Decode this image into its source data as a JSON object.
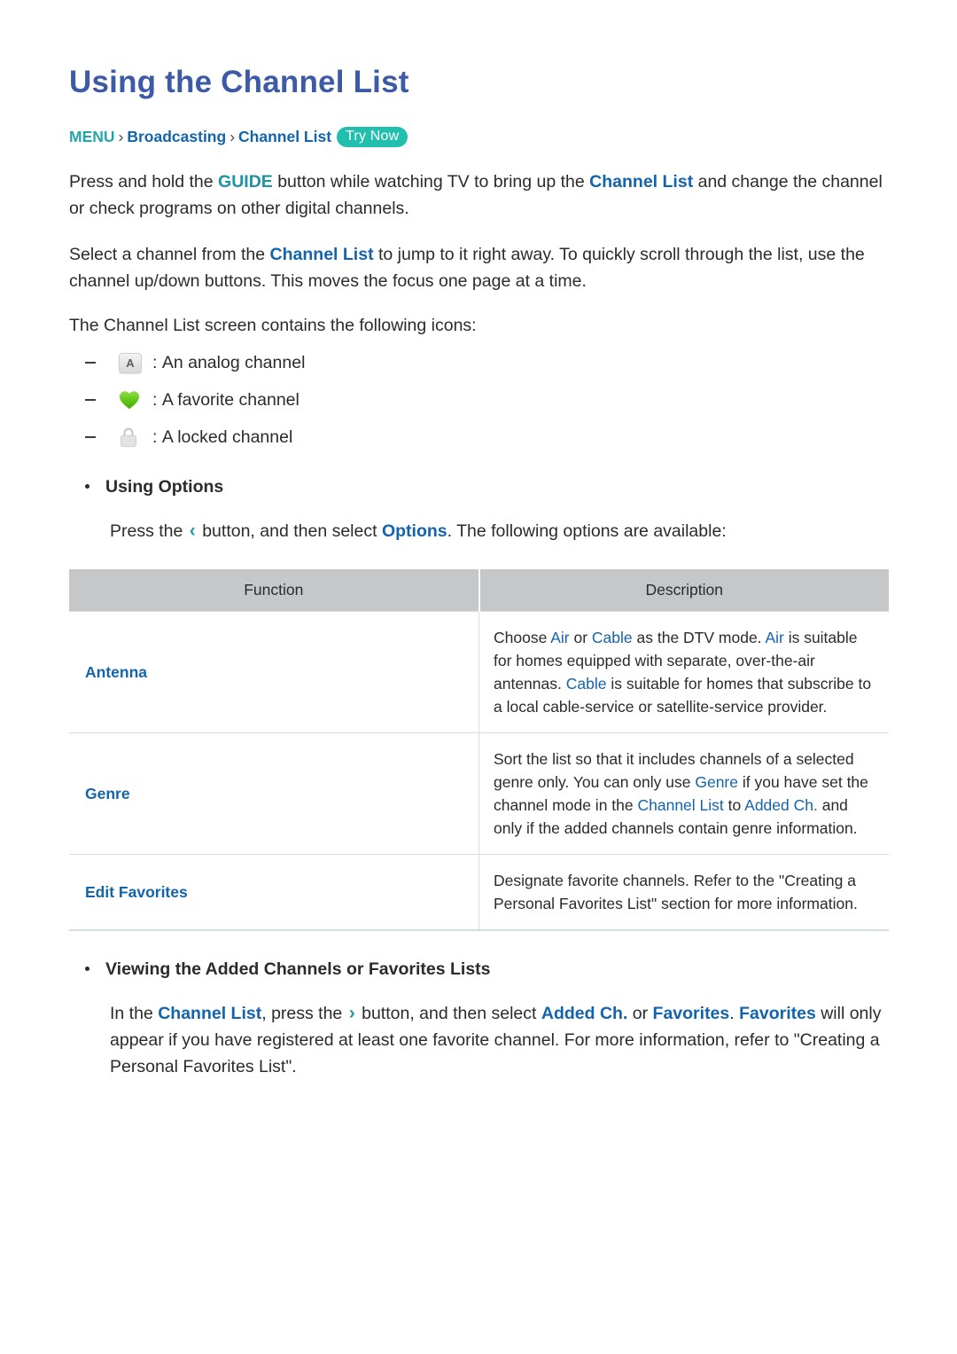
{
  "page": {
    "title": "Using the Channel List"
  },
  "breadcrumb": {
    "root": "MENU",
    "separator": "›",
    "level1": "Broadcasting",
    "level2": "Channel List",
    "badge": "Try Now"
  },
  "paragraphs": {
    "p1_a": "Press and hold the ",
    "p1_guide": "GUIDE",
    "p1_b": " button while watching TV to bring up the ",
    "p1_channel_list": "Channel List",
    "p1_c": " and change the channel or check programs on other digital channels.",
    "p2_a": "Select a channel from the ",
    "p2_channel_list": "Channel List",
    "p2_b": " to jump to it right away. To quickly scroll through the list, use the channel up/down buttons. This moves the focus one page at a time.",
    "p3": "The Channel List screen contains the following icons:"
  },
  "icon_list": [
    {
      "icon": "analog-channel-icon",
      "glyph": "A",
      "colon": ":",
      "label": "An analog channel"
    },
    {
      "icon": "favorite-heart-icon",
      "glyph": "",
      "colon": ":",
      "label": "A favorite channel"
    },
    {
      "icon": "locked-padlock-icon",
      "glyph": "",
      "colon": ":",
      "label": "A locked channel"
    }
  ],
  "using_options": {
    "heading": "Using Options",
    "body_a": "Press the ",
    "chevron": "‹",
    "body_b": " button, and then select ",
    "options_term": "Options",
    "body_c": ". The following options are available:"
  },
  "table": {
    "headers": [
      "Function",
      "Description"
    ],
    "rows": [
      {
        "function": "Antenna",
        "desc_a": "Choose ",
        "t1": "Air",
        "desc_b": " or ",
        "t2": "Cable",
        "desc_c": " as the DTV mode. ",
        "t3": "Air",
        "desc_d": " is suitable for homes equipped with separate, over-the-air antennas. ",
        "t4": "Cable",
        "desc_e": " is suitable for homes that subscribe to a local cable-service or satellite-service provider."
      },
      {
        "function": "Genre",
        "desc_a": "Sort the list so that it includes channels of a selected genre only. You can only use ",
        "t1": "Genre",
        "desc_b": " if you have set the channel mode in the ",
        "t2": "Channel List",
        "desc_c": " to ",
        "t3": "Added Ch.",
        "desc_d": " and only if the added channels contain genre information.",
        "t4": "",
        "desc_e": ""
      },
      {
        "function": "Edit Favorites",
        "desc_a": "Designate favorite channels. Refer to the \"Creating a Personal Favorites List\" section for more information.",
        "t1": "",
        "desc_b": "",
        "t2": "",
        "desc_c": "",
        "t3": "",
        "desc_d": "",
        "t4": "",
        "desc_e": ""
      }
    ]
  },
  "viewing_lists": {
    "heading": "Viewing the Added Channels or Favorites Lists",
    "body_a": "In the ",
    "t_channel_list": "Channel List",
    "body_b": ", press the ",
    "chevron": "›",
    "body_c": " button, and then select ",
    "t_added_ch": "Added Ch.",
    "body_d": " or ",
    "t_favorites": "Favorites",
    "body_e": ". ",
    "t_favorites2": "Favorites",
    "body_f": " will only appear if you have registered at least one favorite channel. For more information, refer to \"Creating a Personal Favorites List\"."
  },
  "colors": {
    "title_blue": "#3d5aa6",
    "link_blue": "#1464ad",
    "teal": "#23a6a8",
    "badge_teal": "#23bfae",
    "table_header_gray": "#c6c7c9",
    "heart_green": "#66cc22"
  }
}
